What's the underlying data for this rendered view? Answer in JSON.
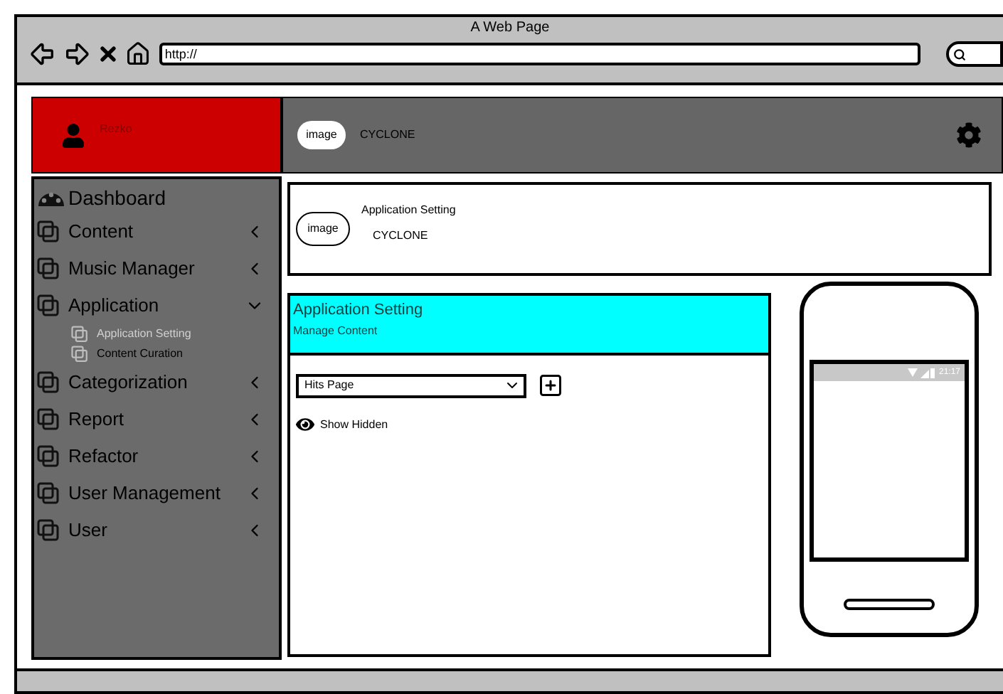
{
  "browser": {
    "title": "A Web Page",
    "url": "http://"
  },
  "header": {
    "user": "Rezko",
    "logo": "image",
    "brand": "CYCLONE"
  },
  "sidebar": {
    "items": [
      {
        "kind": "header",
        "label": "Dashboard"
      },
      {
        "kind": "group",
        "label": "Content",
        "expanded": false
      },
      {
        "kind": "group",
        "label": "Music Manager",
        "expanded": false
      },
      {
        "kind": "group",
        "label": "Application",
        "expanded": true,
        "children": [
          {
            "label": "Application Setting",
            "selected": true
          },
          {
            "label": "Content Curation",
            "selected": false
          }
        ]
      },
      {
        "kind": "group",
        "label": "Categorization",
        "expanded": false
      },
      {
        "kind": "group",
        "label": "Report",
        "expanded": false
      },
      {
        "kind": "group",
        "label": "Refactor",
        "expanded": false
      },
      {
        "kind": "group",
        "label": "User Management",
        "expanded": false
      },
      {
        "kind": "group",
        "label": "User",
        "expanded": false
      }
    ]
  },
  "app_card": {
    "logo": "image",
    "title": "Application Setting",
    "subtitle": "CYCLONE"
  },
  "panel": {
    "title": "Application Setting",
    "subtitle": "Manage Content",
    "dropdown": {
      "value": "Hits Page"
    },
    "toggle": {
      "label": "Show Hidden"
    }
  },
  "phone": {
    "time": "21:17"
  }
}
